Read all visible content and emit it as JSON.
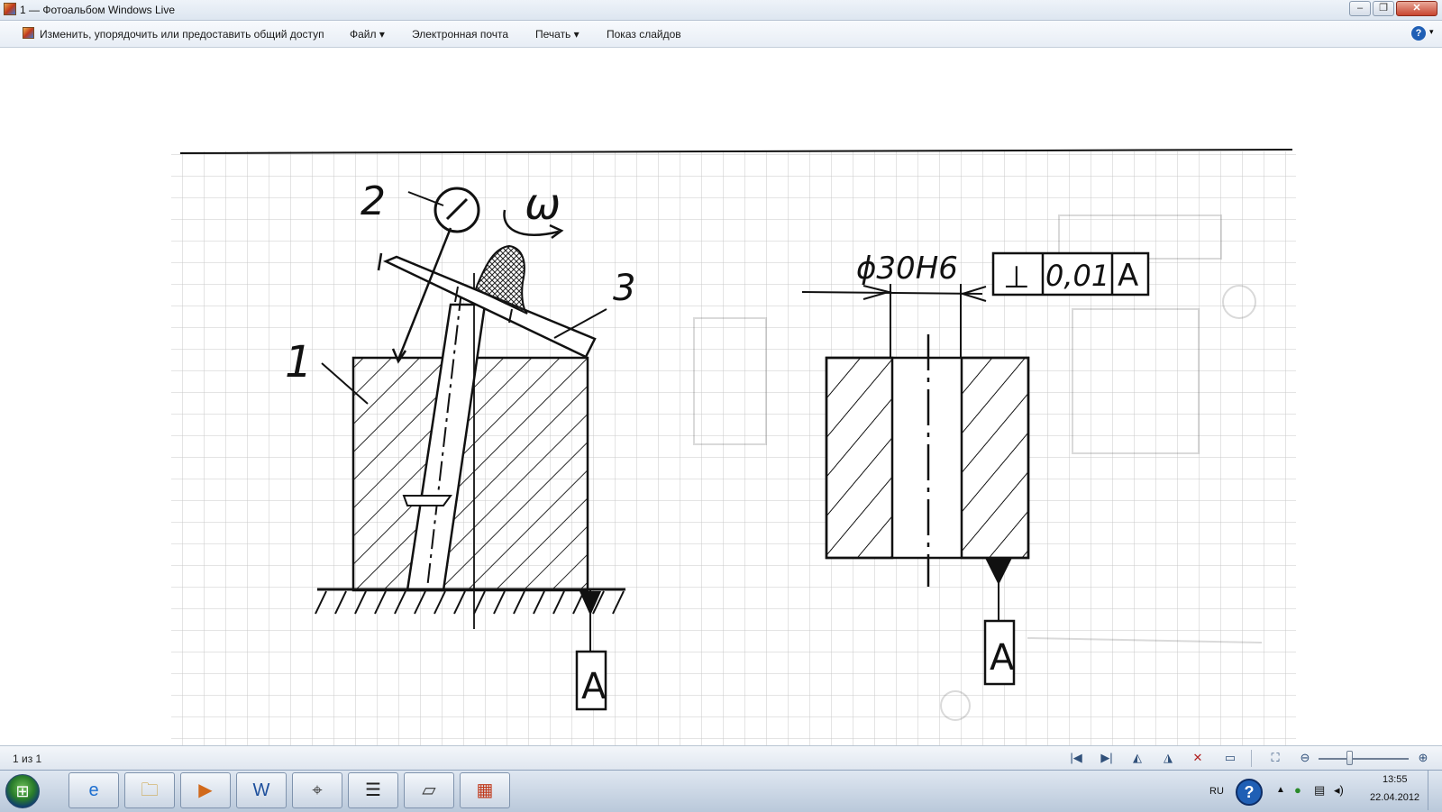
{
  "window": {
    "title": "1 — Фотоальбом Windows Live",
    "minimize_glyph": "‒",
    "maximize_glyph": "❐",
    "close_glyph": "✕"
  },
  "menu": {
    "items": [
      {
        "label": "Изменить, упорядочить или предоставить общий доступ"
      },
      {
        "label": "Файл ▾"
      },
      {
        "label": "Электронная почта"
      },
      {
        "label": "Печать ▾"
      },
      {
        "label": "Показ слайдов"
      }
    ],
    "help_glyph": "?",
    "help_caret": "▾"
  },
  "drawing": {
    "label_1": "1",
    "label_2": "2",
    "label_3": "3",
    "omega": "ω",
    "datum_left": "A",
    "dimension": "ϕ30H6",
    "tolerance_symbol": "⊥",
    "tolerance_value": "0,01",
    "tolerance_datum": "A",
    "datum_right": "A"
  },
  "statusbar": {
    "page_count": "1 из 1",
    "first_glyph": "|◀",
    "next_glyph": "▶|",
    "rotate_left_glyph": "◭",
    "rotate_right_glyph": "◮",
    "delete_glyph": "✕",
    "slideshow_glyph": "▭",
    "fit_glyph": "⛶",
    "zoom_out_glyph": "⊖",
    "zoom_in_glyph": "⊕",
    "zoom_level": 0.35
  },
  "taskbar": {
    "start_glyph": "⊞",
    "apps": [
      {
        "name": "ie",
        "glyph": "e",
        "color": "#1e6fd0"
      },
      {
        "name": "explorer",
        "glyph": "🗀",
        "color": "#c99a2e"
      },
      {
        "name": "media-player",
        "glyph": "▶",
        "color": "#d1691b"
      },
      {
        "name": "word",
        "glyph": "W",
        "color": "#1d4f9c"
      },
      {
        "name": "compass",
        "glyph": "⌖",
        "color": "#444444"
      },
      {
        "name": "archive",
        "glyph": "☰",
        "color": "#222222"
      },
      {
        "name": "scanner",
        "glyph": "▱",
        "color": "#333333"
      },
      {
        "name": "photo-gallery",
        "glyph": "▦",
        "color": "#c0391b"
      }
    ],
    "lang": "RU",
    "help_glyph": "?",
    "time": "13:55",
    "date": "22.04.2012"
  }
}
